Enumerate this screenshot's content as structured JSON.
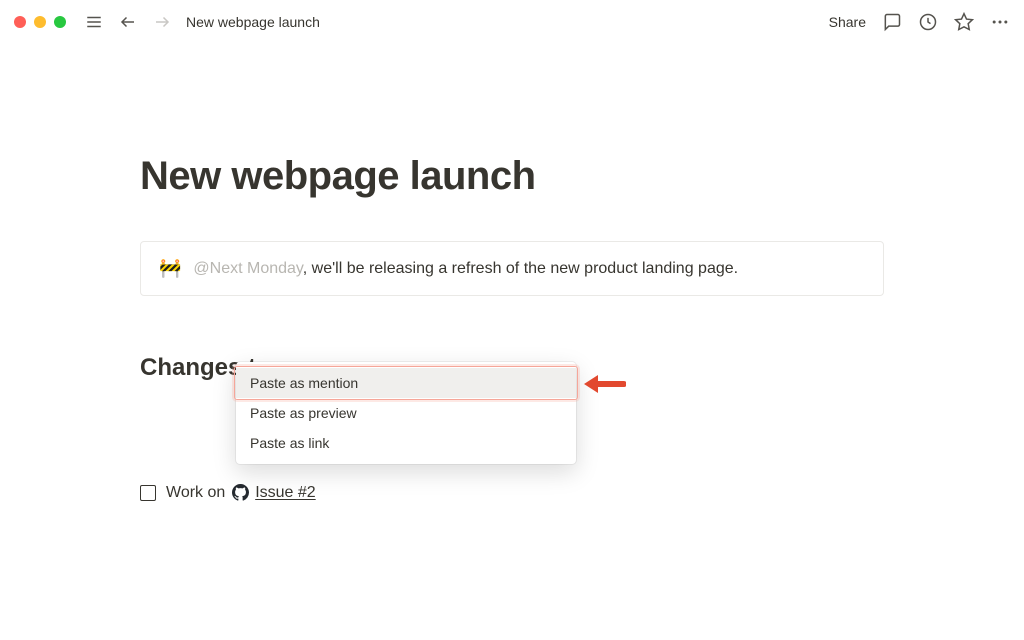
{
  "topbar": {
    "breadcrumb": "New webpage launch",
    "share_label": "Share"
  },
  "page": {
    "title": "New webpage launch",
    "callout": {
      "emoji": "🚧",
      "mention": "@Next Monday",
      "text": ", we'll be releasing a refresh of the new product landing page."
    },
    "heading": "Changes t",
    "todo": {
      "prefix": "Work on ",
      "issue": "Issue #2"
    }
  },
  "paste_menu": {
    "items": [
      {
        "label": "Paste as mention",
        "highlighted": true
      },
      {
        "label": "Paste as preview",
        "highlighted": false
      },
      {
        "label": "Paste as link",
        "highlighted": false
      }
    ]
  }
}
